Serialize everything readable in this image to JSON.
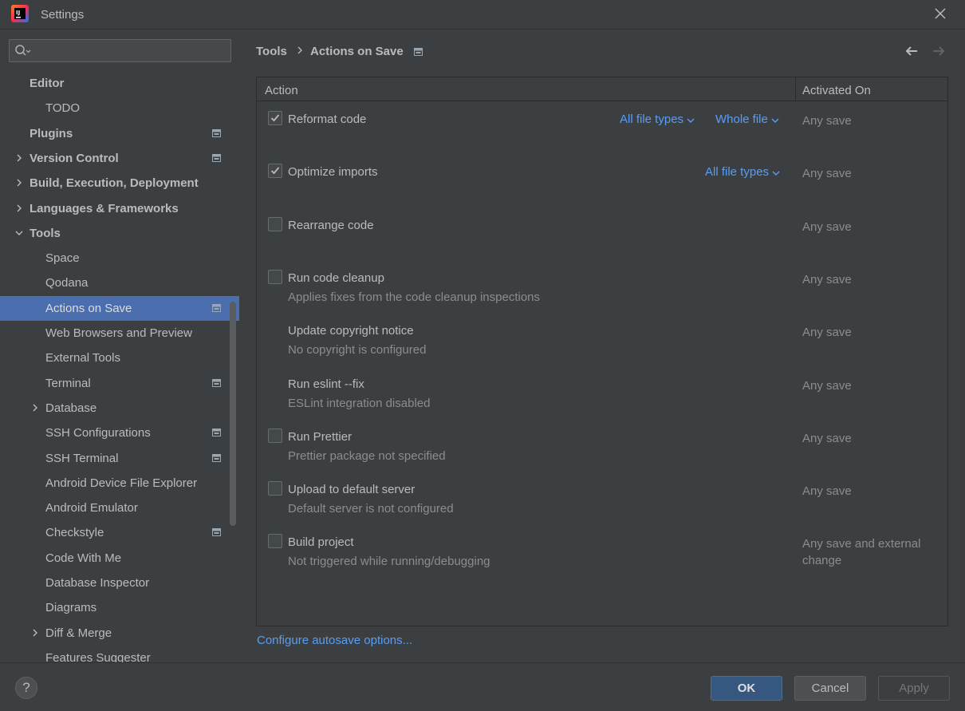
{
  "window": {
    "title": "Settings"
  },
  "search": {
    "placeholder": ""
  },
  "sidebar": {
    "items": [
      {
        "label": "Editor",
        "bold": true,
        "level": 0,
        "expand": "none",
        "proj": false
      },
      {
        "label": "TODO",
        "bold": false,
        "level": 1,
        "expand": "none",
        "proj": false
      },
      {
        "label": "Plugins",
        "bold": true,
        "level": 0,
        "expand": "none",
        "proj": true
      },
      {
        "label": "Version Control",
        "bold": true,
        "level": 0,
        "expand": "collapsed",
        "proj": true
      },
      {
        "label": "Build, Execution, Deployment",
        "bold": true,
        "level": 0,
        "expand": "collapsed",
        "proj": false
      },
      {
        "label": "Languages & Frameworks",
        "bold": true,
        "level": 0,
        "expand": "collapsed",
        "proj": false
      },
      {
        "label": "Tools",
        "bold": true,
        "level": 0,
        "expand": "expanded",
        "proj": false
      },
      {
        "label": "Space",
        "bold": false,
        "level": 1,
        "expand": "none",
        "proj": false
      },
      {
        "label": "Qodana",
        "bold": false,
        "level": 1,
        "expand": "none",
        "proj": false
      },
      {
        "label": "Actions on Save",
        "bold": false,
        "level": 1,
        "expand": "none",
        "proj": true,
        "selected": true
      },
      {
        "label": "Web Browsers and Preview",
        "bold": false,
        "level": 1,
        "expand": "none",
        "proj": false
      },
      {
        "label": "External Tools",
        "bold": false,
        "level": 1,
        "expand": "none",
        "proj": false
      },
      {
        "label": "Terminal",
        "bold": false,
        "level": 1,
        "expand": "none",
        "proj": true
      },
      {
        "label": "Database",
        "bold": false,
        "level": 1,
        "expand": "collapsed",
        "proj": false
      },
      {
        "label": "SSH Configurations",
        "bold": false,
        "level": 1,
        "expand": "none",
        "proj": true
      },
      {
        "label": "SSH Terminal",
        "bold": false,
        "level": 1,
        "expand": "none",
        "proj": true
      },
      {
        "label": "Android Device File Explorer",
        "bold": false,
        "level": 1,
        "expand": "none",
        "proj": false
      },
      {
        "label": "Android Emulator",
        "bold": false,
        "level": 1,
        "expand": "none",
        "proj": false
      },
      {
        "label": "Checkstyle",
        "bold": false,
        "level": 1,
        "expand": "none",
        "proj": true
      },
      {
        "label": "Code With Me",
        "bold": false,
        "level": 1,
        "expand": "none",
        "proj": false
      },
      {
        "label": "Database Inspector",
        "bold": false,
        "level": 1,
        "expand": "none",
        "proj": false
      },
      {
        "label": "Diagrams",
        "bold": false,
        "level": 1,
        "expand": "none",
        "proj": false
      },
      {
        "label": "Diff & Merge",
        "bold": false,
        "level": 1,
        "expand": "collapsed",
        "proj": false
      },
      {
        "label": "Features Suggester",
        "bold": false,
        "level": 1,
        "expand": "none",
        "proj": false
      }
    ]
  },
  "breadcrumb": {
    "parent": "Tools",
    "current": "Actions on Save"
  },
  "table": {
    "col_action": "Action",
    "col_activated": "Activated On",
    "rows": [
      {
        "title": "Reformat code",
        "subtitle": "",
        "checkbox": true,
        "checked": true,
        "activated": "Any save",
        "links": [
          "All file types",
          "Whole file"
        ]
      },
      {
        "title": "Optimize imports",
        "subtitle": "",
        "checkbox": true,
        "checked": true,
        "activated": "Any save",
        "links": [
          "All file types"
        ]
      },
      {
        "title": "Rearrange code",
        "subtitle": "",
        "checkbox": true,
        "checked": false,
        "activated": "Any save",
        "links": []
      },
      {
        "title": "Run code cleanup",
        "subtitle": "Applies fixes from the code cleanup inspections",
        "checkbox": true,
        "checked": false,
        "activated": "Any save",
        "links": []
      },
      {
        "title": "Update copyright notice",
        "subtitle": "No copyright is configured",
        "checkbox": false,
        "checked": false,
        "activated": "Any save",
        "links": []
      },
      {
        "title": "Run eslint --fix",
        "subtitle": "ESLint integration disabled",
        "checkbox": false,
        "checked": false,
        "activated": "Any save",
        "links": []
      },
      {
        "title": "Run Prettier",
        "subtitle": "Prettier package not specified",
        "checkbox": true,
        "checked": false,
        "activated": "Any save",
        "links": []
      },
      {
        "title": "Upload to default server",
        "subtitle": "Default server is not configured",
        "checkbox": true,
        "checked": false,
        "activated": "Any save",
        "links": []
      },
      {
        "title": "Build project",
        "subtitle": "Not triggered while running/debugging",
        "checkbox": true,
        "checked": false,
        "activated": "Any save and external change",
        "links": []
      }
    ]
  },
  "configure_link": "Configure autosave options...",
  "footer": {
    "help": "?",
    "ok": "OK",
    "cancel": "Cancel",
    "apply": "Apply"
  },
  "colors": {
    "accent": "#4b6eaf",
    "link": "#589df6",
    "background": "#3c3f41"
  }
}
